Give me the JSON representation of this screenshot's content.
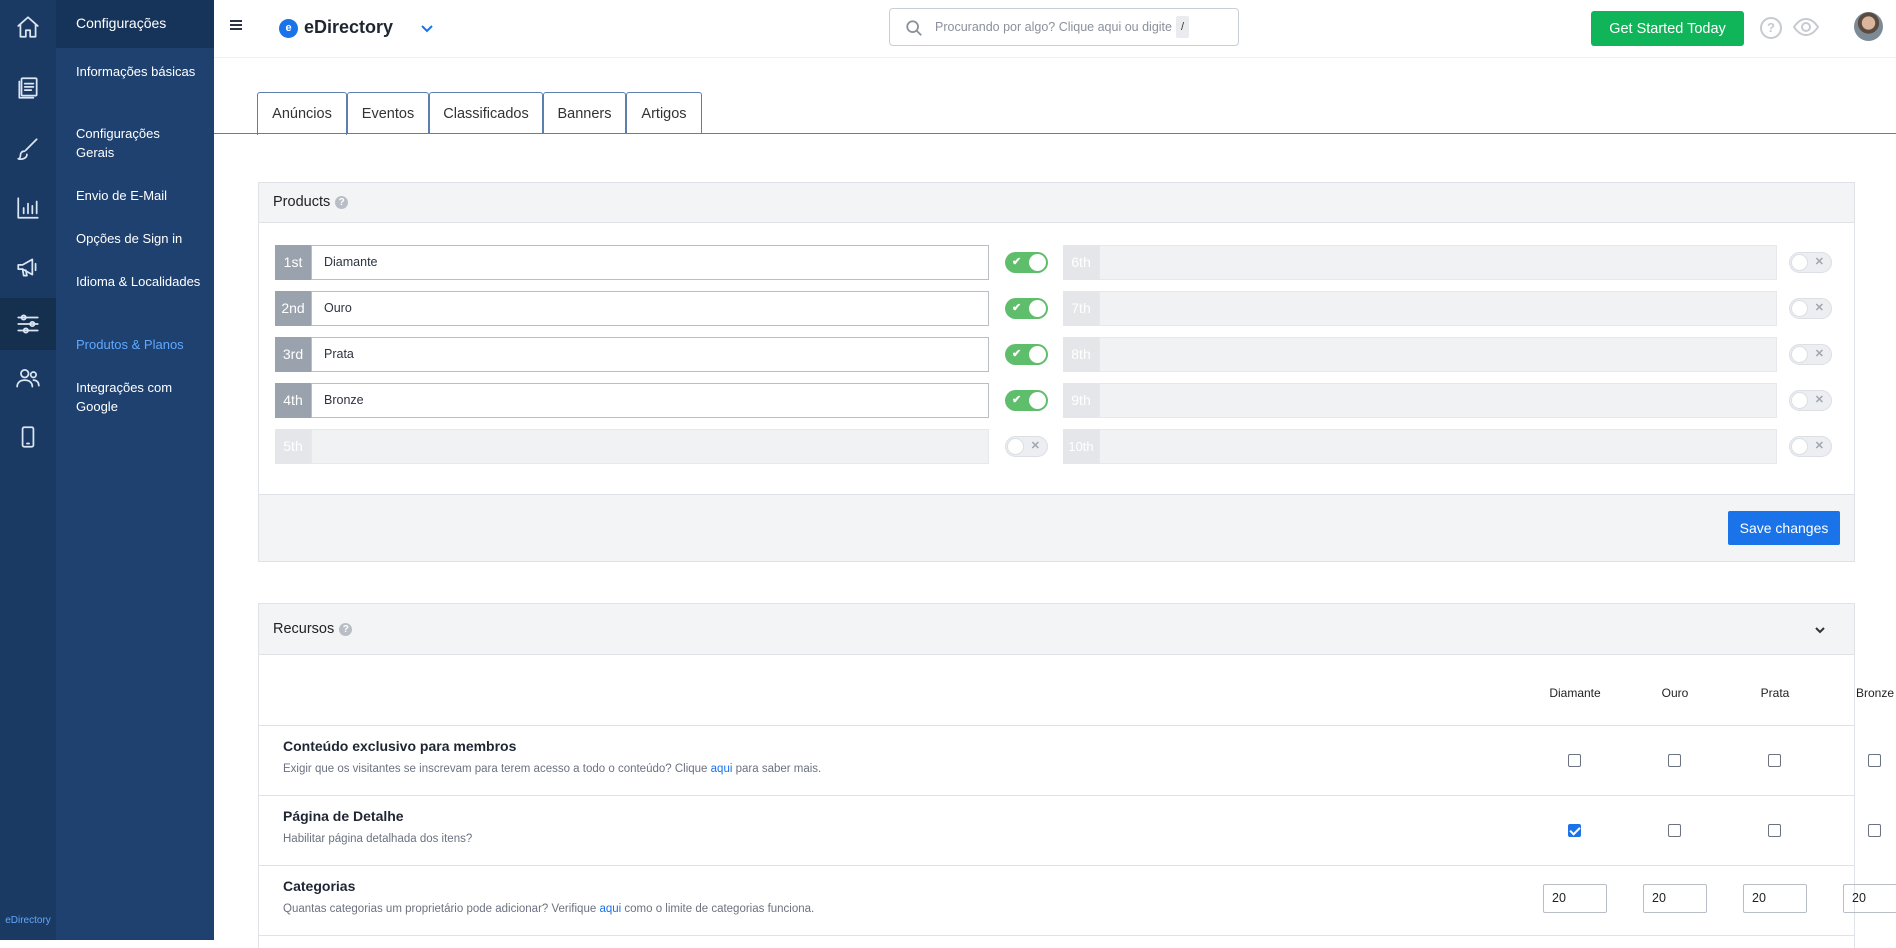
{
  "rail": {
    "items": [
      {
        "icon": "home-icon"
      },
      {
        "icon": "content-icon"
      },
      {
        "icon": "design-brush-icon"
      },
      {
        "icon": "reports-chart-icon"
      },
      {
        "icon": "promotion-megaphone-icon"
      },
      {
        "icon": "settings-sliders-icon",
        "active": true
      },
      {
        "icon": "users-icon"
      },
      {
        "icon": "mobile-app-icon"
      }
    ],
    "brand": "eDirectory"
  },
  "sidebar": {
    "title": "Configurações",
    "items": [
      {
        "label": "Informações básicas"
      },
      {
        "label": "Configurações Gerais"
      },
      {
        "label": "Envio de E-Mail"
      },
      {
        "label": "Opções de Sign in"
      },
      {
        "label": "Idioma & Localidades"
      },
      {
        "label": "Produtos & Planos",
        "active": true
      },
      {
        "label": "Integrações com Google"
      }
    ]
  },
  "header": {
    "brand": "eDirectory",
    "brand_logo": "e",
    "search_placeholder": "Procurando por algo? Clique aqui ou digite",
    "search_shortcut": "/",
    "cta": "Get Started Today",
    "help": "?",
    "accent": "#1a73e8",
    "cta_color": "#10b559"
  },
  "tabs": [
    "Anúncios",
    "Eventos",
    "Classificados",
    "Banners",
    "Artigos"
  ],
  "products": {
    "title": "Products",
    "levels": [
      {
        "label": "1st",
        "value": "Diamante",
        "enabled": true
      },
      {
        "label": "2nd",
        "value": "Ouro",
        "enabled": true
      },
      {
        "label": "3rd",
        "value": "Prata",
        "enabled": true
      },
      {
        "label": "4th",
        "value": "Bronze",
        "enabled": true
      },
      {
        "label": "5th",
        "value": "",
        "enabled": false
      },
      {
        "label": "6th",
        "value": "",
        "enabled": false
      },
      {
        "label": "7th",
        "value": "",
        "enabled": false
      },
      {
        "label": "8th",
        "value": "",
        "enabled": false
      },
      {
        "label": "9th",
        "value": "",
        "enabled": false
      },
      {
        "label": "10th",
        "value": "",
        "enabled": false
      }
    ],
    "save": "Save changes"
  },
  "resources": {
    "title": "Recursos",
    "columns": [
      "Diamante",
      "Ouro",
      "Prata",
      "Bronze"
    ],
    "rows": [
      {
        "title": "Conteúdo exclusivo para membros",
        "desc_before": "Exigir que os visitantes se inscrevam para terem acesso a todo o conteúdo? Clique ",
        "link": "aqui",
        "desc_after": " para saber mais.",
        "type": "checkbox",
        "values": [
          false,
          false,
          false,
          false
        ]
      },
      {
        "title": "Página de Detalhe",
        "desc_before": "Habilitar página detalhada dos itens?",
        "link": "",
        "desc_after": "",
        "type": "checkbox",
        "values": [
          true,
          false,
          false,
          false
        ]
      },
      {
        "title": "Categorias",
        "desc_before": "Quantas categorias um proprietário pode adicionar? Verifique ",
        "link": "aqui",
        "desc_after": " como o limite de categorias funciona.",
        "type": "number",
        "values": [
          "20",
          "20",
          "20",
          "20"
        ]
      }
    ]
  }
}
